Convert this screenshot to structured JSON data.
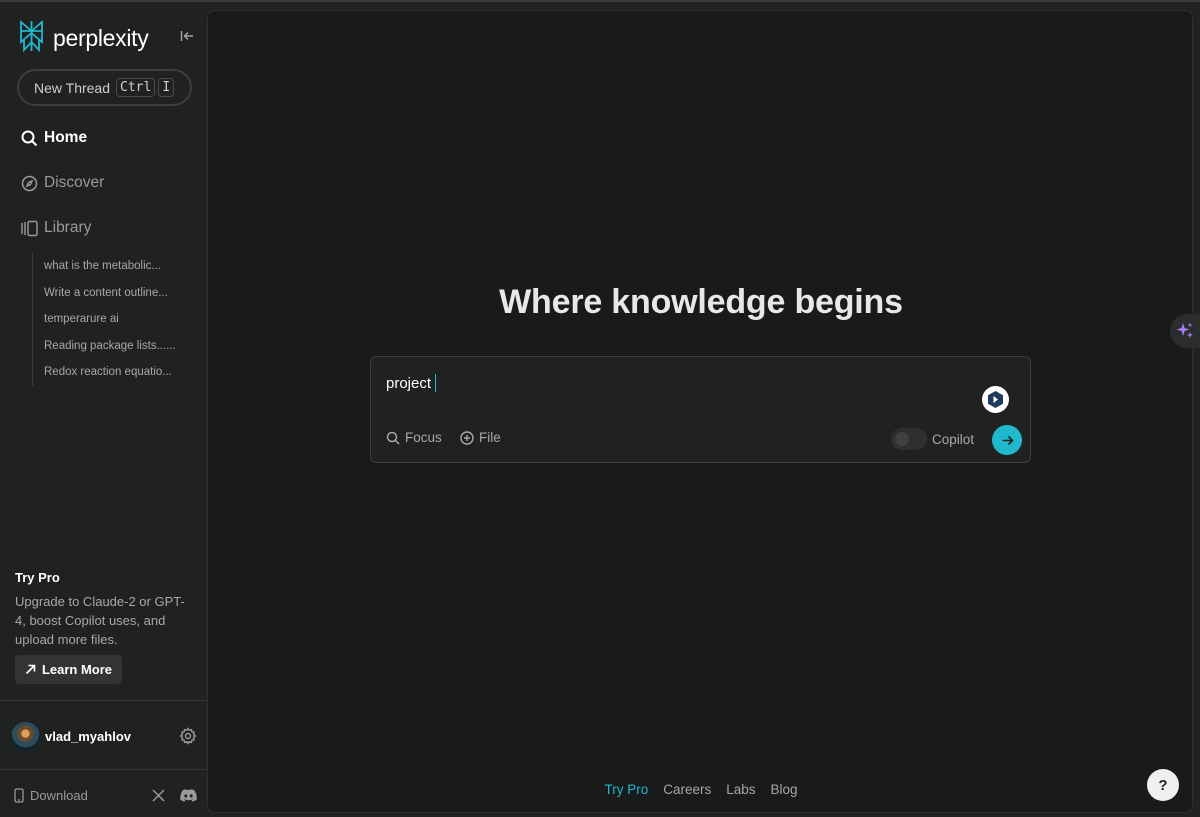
{
  "sidebar": {
    "logo_text": "perplexity",
    "new_thread": {
      "label": "New Thread",
      "kbd1": "Ctrl",
      "kbd2": "I"
    },
    "nav": {
      "home": "Home",
      "discover": "Discover",
      "library": "Library"
    },
    "library_items": [
      "what is the metabolic...",
      "Write a content outline...",
      "temperarure ai",
      "Reading package lists......",
      "Redox reaction equatio..."
    ],
    "pro": {
      "title": "Try Pro",
      "description": "Upgrade to Claude-2 or GPT-4, boost Copilot uses, and upload more files.",
      "button": "Learn More"
    },
    "user": {
      "name": "vlad_myahlov"
    },
    "download_label": "Download"
  },
  "main": {
    "headline": "Where knowledge begins",
    "search": {
      "query": "project",
      "focus_label": "Focus",
      "file_label": "File",
      "copilot_label": "Copilot",
      "copilot_enabled": false
    },
    "footer": [
      "Try Pro",
      "Careers",
      "Labs",
      "Blog"
    ],
    "help_label": "?"
  },
  "colors": {
    "accent": "#1fb8cd",
    "background": "#202222",
    "panel": "#191a1a"
  },
  "icons": [
    "perplexity-logo-icon",
    "collapse-sidebar-icon",
    "search-icon",
    "compass-icon",
    "library-icon",
    "arrow-up-right-icon",
    "gear-icon",
    "phone-icon",
    "x-logo-icon",
    "discord-icon",
    "focus-search-icon",
    "plus-circle-icon",
    "arrow-right-icon",
    "extension-icon",
    "sparkle-icon"
  ]
}
